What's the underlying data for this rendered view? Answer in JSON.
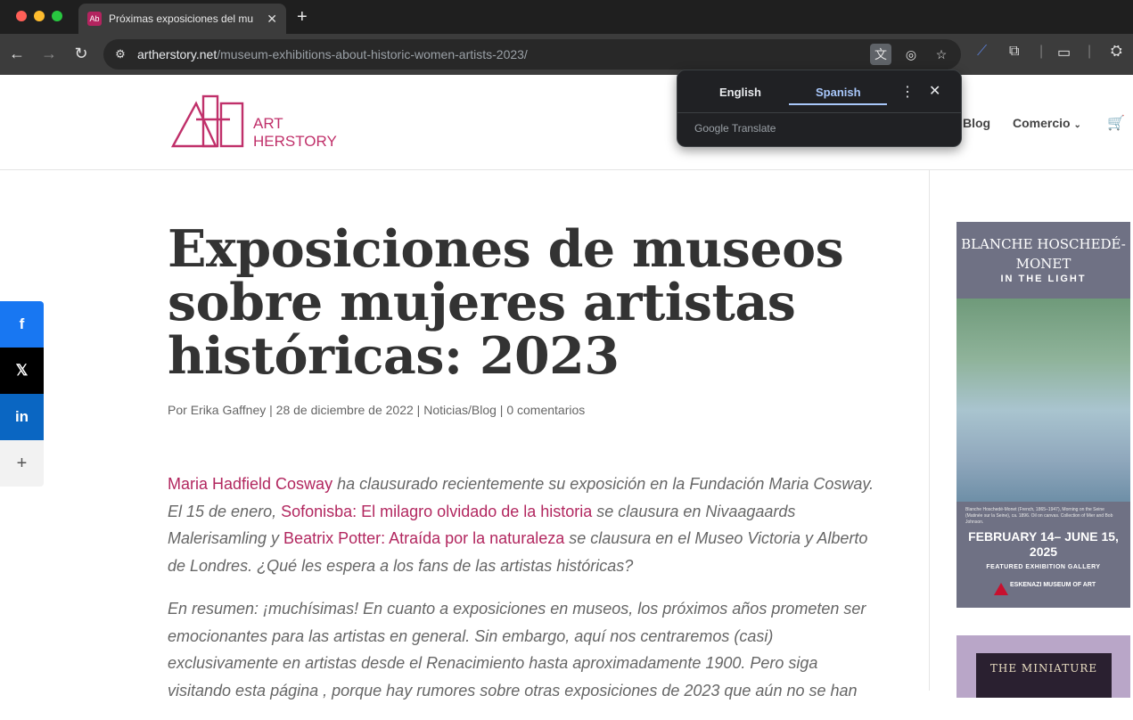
{
  "browser": {
    "tab_title": "Próximas exposiciones del mu",
    "favicon_text": "Ab",
    "url_host": "artherstory.net",
    "url_path": "/museum-exhibitions-about-historic-women-artists-2023/"
  },
  "translate_popup": {
    "lang_source": "English",
    "lang_target": "Spanish",
    "brand": "Google Translate"
  },
  "site": {
    "logo_line1": "ART",
    "logo_line2": "HERSTORY",
    "nav_blog": "Blog",
    "nav_shop": "Comercio",
    "accent_color": "#b2275f"
  },
  "post": {
    "title": "Exposiciones de museos sobre mujeres artistas históricas: 2023",
    "meta_prefix": "Por ",
    "author": "Erika Gaffney",
    "sep1": " | ",
    "date": "28 de diciembre de 2022",
    "sep2": " | ",
    "category": "Noticias/Blog",
    "sep3": " | ",
    "comments": "0 comentarios",
    "p1_link1": "Maria Hadfield Cosway",
    "p1_text1": " ha clausurado recientemente su exposición en la Fundación Maria Cosway. El 15 de enero, ",
    "p1_link2": "Sofonisba: El milagro olvidado de la historia",
    "p1_text2": " se clausura en Nivaagaards Malerisamling y ",
    "p1_link3": "Beatrix Potter: Atraída por la naturaleza",
    "p1_text3": " se clausura en el Museo Victoria y Alberto de Londres. ¿Qué les espera a los fans de las artistas históricas?",
    "p2": "En resumen: ¡muchísimas! En cuanto a exposiciones en museos, los próximos años prometen ser emocionantes para las artistas en general. Sin embargo, aquí nos centraremos (casi) exclusivamente en artistas desde el Renacimiento hasta aproximadamente 1900. Pero siga visitando esta página , porque hay rumores sobre otras exposiciones de 2023 que aún no se han"
  },
  "social": [
    "facebook",
    "x",
    "linkedin",
    "more"
  ],
  "ad1": {
    "title": "BLANCHE HOSCHEDÉ-MONET",
    "subtitle": "IN THE LIGHT",
    "caption": "Blanche Hoschedé-Monet (French, 1865–1947), Morning on the Seine (Matinée sur la Seine), ca. 1896. Oil on canvas. Collection of Mier and Bob Johnson.",
    "dates": "FEBRUARY 14– JUNE 15, 2025",
    "gallery": "FEATURED EXHIBITION GALLERY",
    "museum": "ESKENAZI MUSEUM OF ART"
  },
  "ad2": {
    "text": "THE MINIATURE"
  }
}
